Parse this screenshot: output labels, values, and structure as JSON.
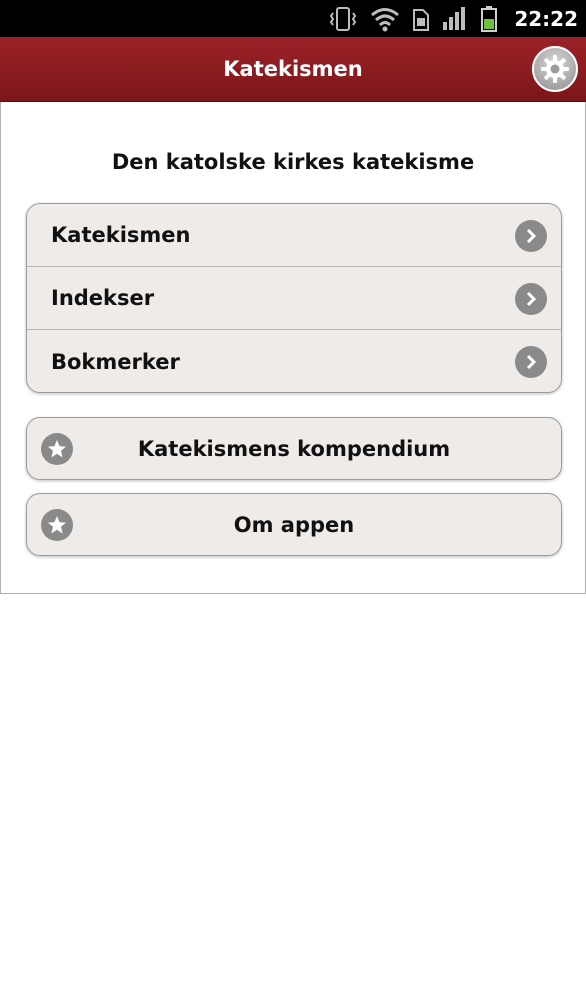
{
  "status_bar": {
    "time": "22:22",
    "icons": [
      "vibrate-icon",
      "wifi-icon",
      "sim-icon",
      "signal-icon",
      "battery-icon"
    ]
  },
  "app_bar": {
    "title": "Katekismen",
    "settings_icon": "gear-icon"
  },
  "main": {
    "heading": "Den katolske kirkes katekisme",
    "menu_items": [
      {
        "label": "Katekismen",
        "icon": "chevron-right-icon"
      },
      {
        "label": "Indekser",
        "icon": "chevron-right-icon"
      },
      {
        "label": "Bokmerker",
        "icon": "chevron-right-icon"
      }
    ],
    "buttons": [
      {
        "label": "Katekismens kompendium",
        "icon": "star-icon"
      },
      {
        "label": "Om appen",
        "icon": "star-icon"
      }
    ]
  },
  "colors": {
    "app_bar": "#8b1c20",
    "item_background": "#efebe8",
    "icon_gray": "#8a8a8a"
  }
}
